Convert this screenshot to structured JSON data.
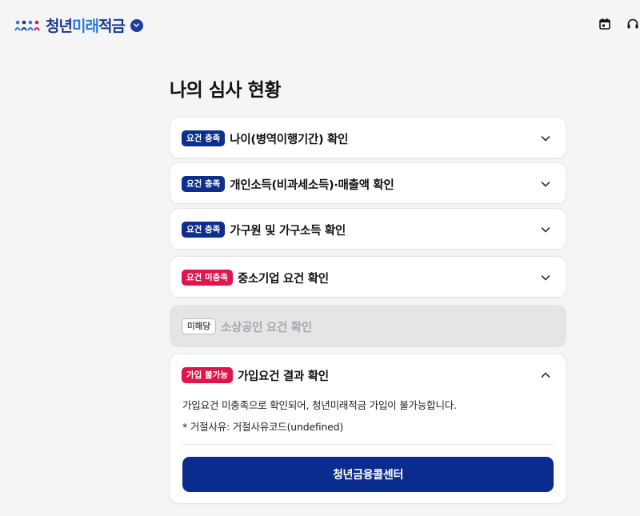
{
  "header": {
    "logo_text_1": "청년",
    "logo_text_2": "미래",
    "logo_text_3": "적금",
    "icons": [
      "calendar-icon",
      "headset-icon"
    ]
  },
  "page_title": "나의 심사 현황",
  "cards": [
    {
      "badge": "요건 충족",
      "status": "met",
      "title": "나이(병역이행기간) 확인",
      "expanded": false
    },
    {
      "badge": "요건 충족",
      "status": "met",
      "title": "개인소득(비과세소득)·매출액 확인",
      "expanded": false
    },
    {
      "badge": "요건 충족",
      "status": "met",
      "title": "가구원 및 가구소득 확인",
      "expanded": false
    },
    {
      "badge": "요건 미충족",
      "status": "unmet",
      "title": "중소기업 요건 확인",
      "expanded": false
    },
    {
      "badge": "미해당",
      "status": "na",
      "title": "소상공인 요건 확인",
      "expanded": false
    }
  ],
  "result": {
    "badge": "가입 불가능",
    "title": "가입요건 결과 확인",
    "expanded": true,
    "message": "가입요건 미충족으로 확인되어, 청년미래적금 가입이 불가능합니다.",
    "reason": "* 거절사유: 거절사유코드(undefined)",
    "cta_label": "청년금융콜센터"
  },
  "colors": {
    "met_badge": "#0d2f8c",
    "unmet_badge": "#e0154e",
    "primary_button": "#0b2c8f",
    "background": "#f5f5f6"
  }
}
